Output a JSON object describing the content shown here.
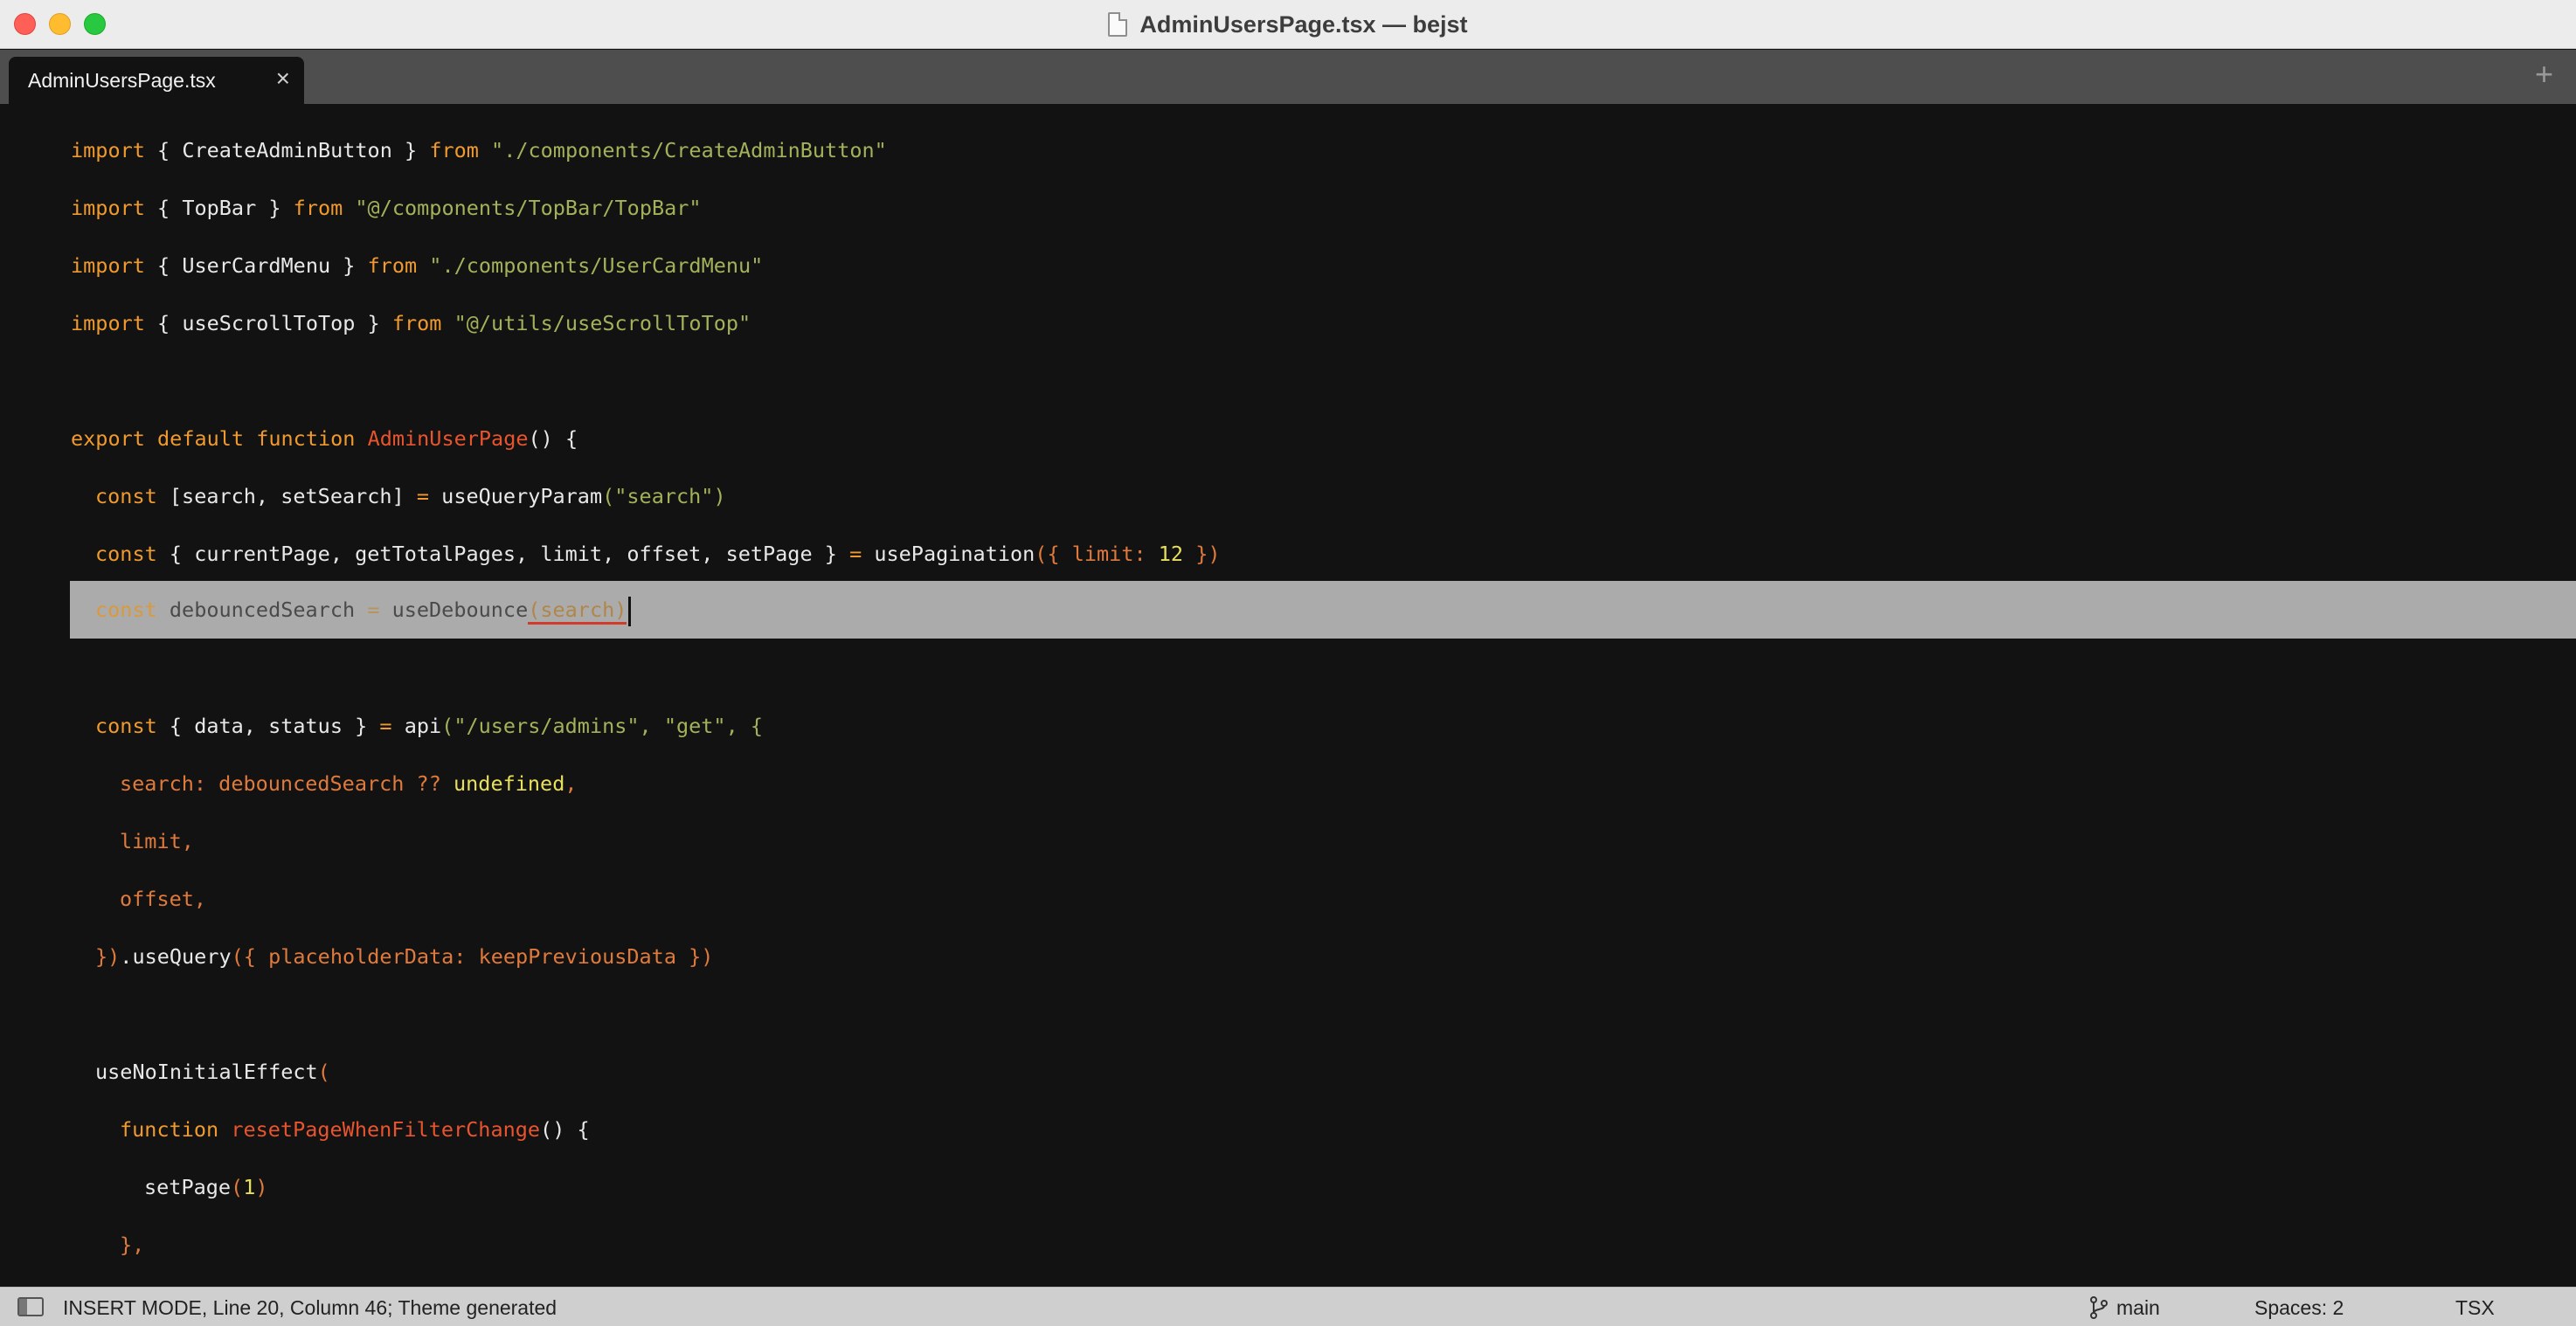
{
  "window": {
    "title": "AdminUsersPage.tsx — bejst"
  },
  "tabs": [
    {
      "label": "AdminUsersPage.tsx",
      "close": "×"
    }
  ],
  "tab_add": "+",
  "code": {
    "l1": {
      "kw1": "import",
      "mid": " { CreateAdminButton } ",
      "kw2": "from",
      "str": " \"./components/CreateAdminButton\""
    },
    "l2": {
      "kw1": "import",
      "mid": " { TopBar } ",
      "kw2": "from",
      "str": " \"@/components/TopBar/TopBar\""
    },
    "l3": {
      "kw1": "import",
      "mid": " { UserCardMenu } ",
      "kw2": "from",
      "str": " \"./components/UserCardMenu\""
    },
    "l4": {
      "kw1": "import",
      "mid": " { useScrollToTop } ",
      "kw2": "from",
      "str": " \"@/utils/useScrollToTop\""
    },
    "l6": {
      "kw": "export default function",
      "fn": " AdminUserPage",
      "rest": "() {"
    },
    "l7": {
      "kw": "const",
      "mid": " [search, setSearch] ",
      "op": "=",
      "call": " useQueryParam",
      "arg": "(\"search\")"
    },
    "l8": {
      "kw": "const",
      "mid": " { currentPage, getTotalPages, limit, offset, setPage } ",
      "op": "=",
      "call": " usePagination",
      "a1": "({ limit: ",
      "num": "12",
      "a2": " })"
    },
    "l9": {
      "kw": "const",
      "mid": " debouncedSearch ",
      "op": "=",
      "call": " useDebounce",
      "arg": "(search)"
    },
    "l11": {
      "kw": "const",
      "mid": " { data, status } ",
      "op": "=",
      "call": " api",
      "arg": "(\"/users/admins\", \"get\", {"
    },
    "l12": {
      "key": "search: debouncedSearch ?? ",
      "val": "undefined",
      "end": ","
    },
    "l13": {
      "text": "limit,"
    },
    "l14": {
      "text": "offset,"
    },
    "l15": {
      "a": "})",
      "b": ".useQuery",
      "c": "({ placeholderData: keepPreviousData })"
    },
    "l17": {
      "call": "useNoInitialEffect",
      "paren": "("
    },
    "l18": {
      "kw": "function",
      "fn": " resetPageWhenFilterChange",
      "rest": "() {"
    },
    "l19": {
      "call": "setPage",
      "p1": "(",
      "num": "1",
      "p2": ")"
    },
    "l20": {
      "text": "},"
    }
  },
  "status": {
    "mode": "INSERT MODE, Line 20, Column 46; Theme generated",
    "branch": "main",
    "spaces": "Spaces: 2",
    "syntax": "TSX"
  }
}
